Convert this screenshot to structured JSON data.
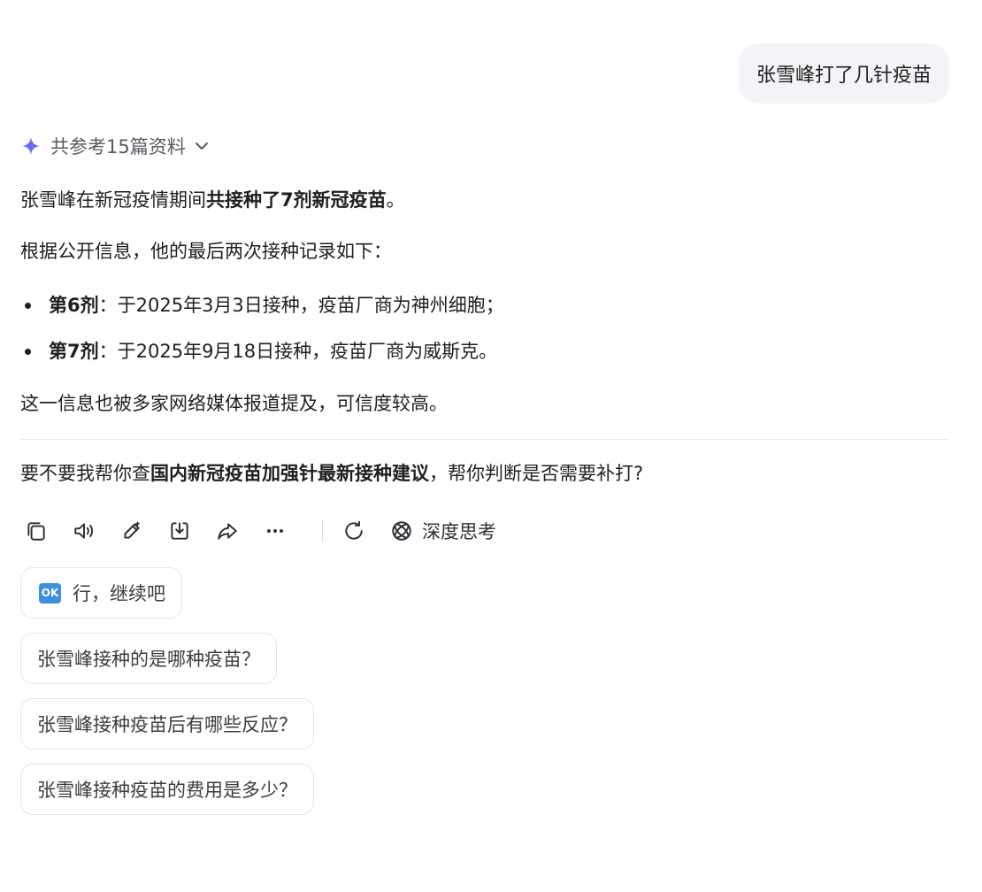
{
  "user_message": "张雪峰打了几针疫苗",
  "references": {
    "label": "共参考15篇资料"
  },
  "answer": {
    "p1_pre": "张雪峰在新冠疫情期间",
    "p1_bold": "共接种了7剂新冠疫苗",
    "p1_post": "。",
    "p2": "根据公开信息，他的最后两次接种记录如下：",
    "items": [
      {
        "label": "第6剂",
        "text": "：于2025年3月3日接种，疫苗厂商为神州细胞；"
      },
      {
        "label": "第7剂",
        "text": "：于2025年9月18日接种，疫苗厂商为威斯克。"
      }
    ],
    "p3": "这一信息也被多家网络媒体报道提及，可信度较高。",
    "p4_pre": "要不要我帮你查",
    "p4_bold": "国内新冠疫苗加强针最新接种建议",
    "p4_post": "，帮你判断是否需要补打?"
  },
  "toolbar": {
    "deep_think_label": "深度思考"
  },
  "suggestions": {
    "ok_badge": "OK",
    "items": [
      "行，继续吧",
      "张雪峰接种的是哪种疫苗？",
      "张雪峰接种疫苗后有哪些反应？",
      "张雪峰接种疫苗的费用是多少？"
    ]
  },
  "colors": {
    "accent_spark": "#6b6cf6",
    "bubble_bg": "#f3f4f7",
    "ok_badge": "#3d8fe0"
  }
}
